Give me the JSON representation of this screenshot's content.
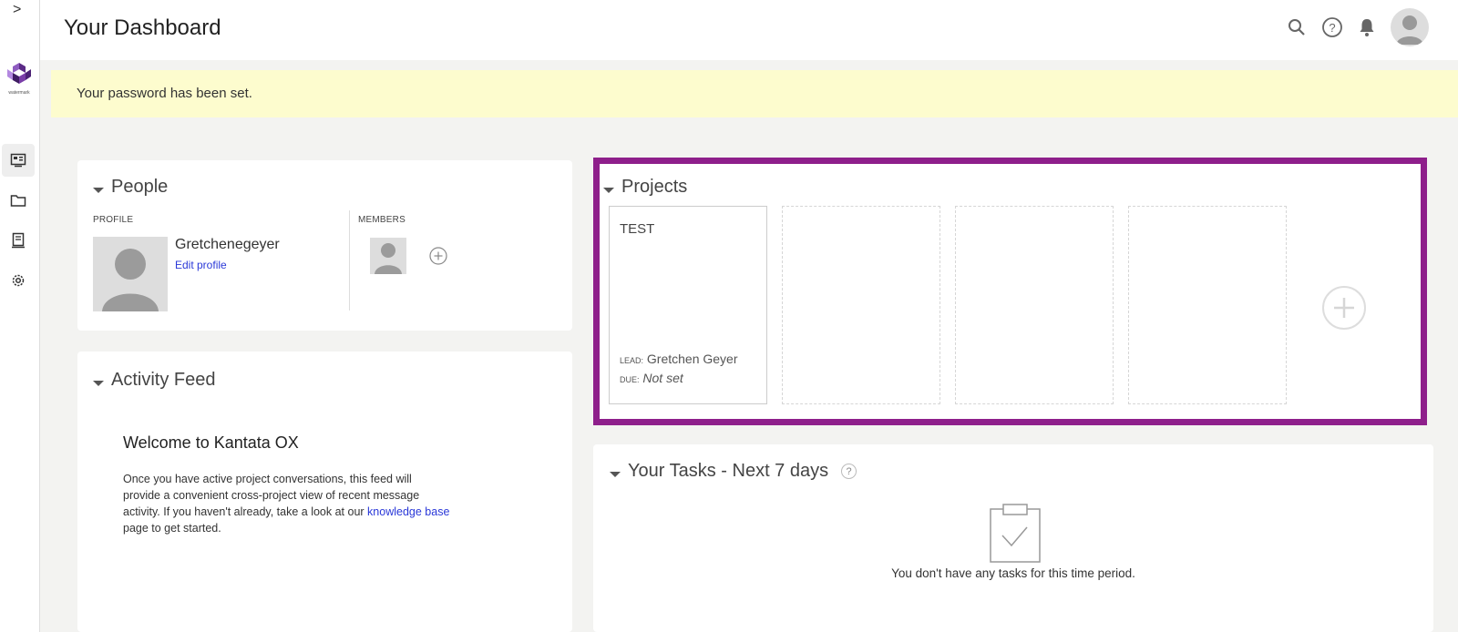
{
  "rail": {
    "expand_glyph": ">",
    "logo_text": "watermark",
    "items": [
      {
        "icon": "dashboard-icon",
        "active": true
      },
      {
        "icon": "folder-icon",
        "active": false
      },
      {
        "icon": "document-icon",
        "active": false
      },
      {
        "icon": "gear-icon",
        "active": false
      }
    ]
  },
  "header": {
    "title": "Your Dashboard",
    "icons": [
      "search-icon",
      "help-icon",
      "bell-icon",
      "avatar"
    ]
  },
  "banner": {
    "message": "Your password has been set."
  },
  "people": {
    "title": "People",
    "profile_label": "PROFILE",
    "members_label": "MEMBERS",
    "user_name": "Gretchenegeyer",
    "edit_profile": "Edit profile"
  },
  "activity": {
    "title": "Activity Feed",
    "welcome_heading": "Welcome to Kantata OX",
    "body_line1": "Once you have active project conversations, this feed will",
    "body_line2": "provide a convenient cross-project view of recent message",
    "body_line3_pre": "activity. If you haven't already, take a look at our ",
    "body_link": "knowledge base",
    "body_line4": "page to get started."
  },
  "projects": {
    "title": "Projects",
    "items": [
      {
        "name": "TEST",
        "lead_label": "LEAD:",
        "lead": "Gretchen Geyer",
        "due_label": "DUE:",
        "due": "Not set"
      }
    ],
    "accent": "#8e1f8b"
  },
  "tasks": {
    "title": "Your Tasks - Next 7 days",
    "help_glyph": "?",
    "empty_message": "You don't have any tasks for this time period."
  },
  "colors": {
    "banner_bg": "#fdfcce",
    "link": "#2a38d8",
    "page_bg": "#f3f3f1"
  }
}
